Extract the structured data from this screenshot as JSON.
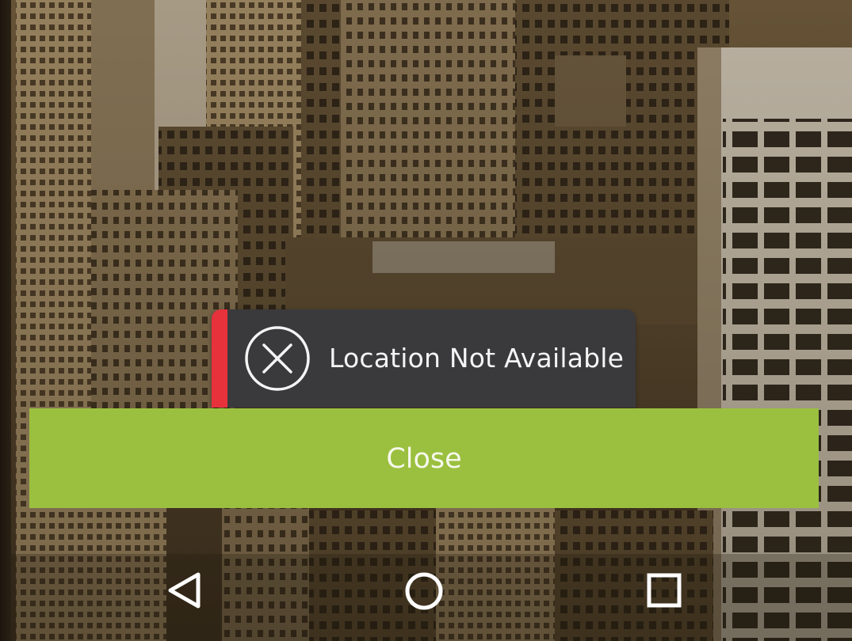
{
  "toast": {
    "message": "Location Not Available",
    "icon": "circle-x-icon",
    "accent_color": "#e7323c",
    "background_color": "#3a3a3c"
  },
  "dialog": {
    "close_label": "Close",
    "button_color": "#9bc03f"
  },
  "navigation_bar": {
    "back_icon": "back-triangle-icon",
    "home_icon": "home-circle-icon",
    "recents_icon": "recents-square-icon"
  }
}
